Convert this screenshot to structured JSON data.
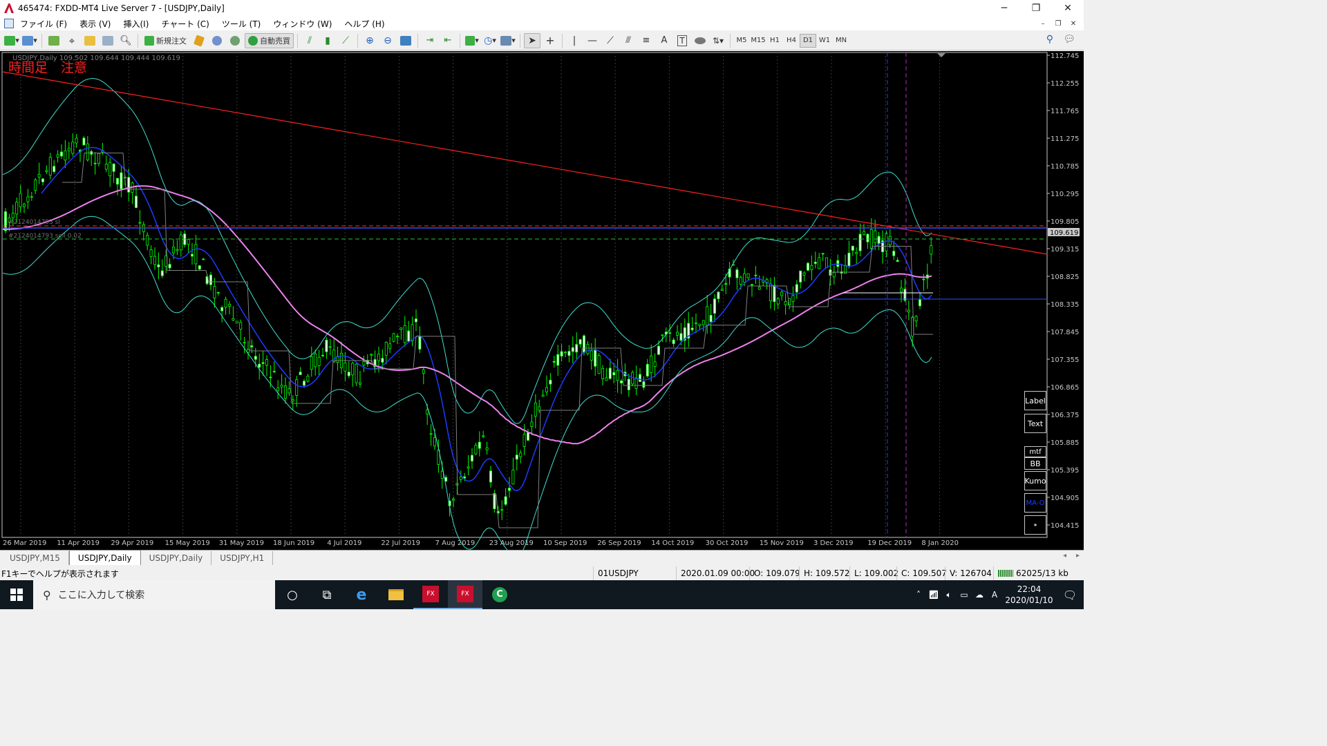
{
  "window": {
    "title": "465474: FXDD-MT4 Live Server 7 - [USDJPY,Daily]",
    "min": "─",
    "max": "❐",
    "close": "✕"
  },
  "menu": [
    "ファイル (F)",
    "表示 (V)",
    "挿入(I)",
    "チャート (C)",
    "ツール (T)",
    "ウィンドウ (W)",
    "ヘルプ (H)"
  ],
  "toolbar": {
    "new_order": "新規注文",
    "auto_trade": "自動売買",
    "timeframes": [
      "M5",
      "M15",
      "H1",
      "H4",
      "D1",
      "W1",
      "MN"
    ],
    "active_tf": "D1"
  },
  "chart": {
    "symbol_info": "USDJPY,Daily  109.502 109.644 109.444 109.619",
    "annotation": "時間足　注意",
    "order_label_1": "#2124014793 sl",
    "order_label_2": "#2124014793 sell 0.02",
    "current_price": "109.619",
    "price_axis": [
      "112.745",
      "112.255",
      "111.765",
      "111.275",
      "110.785",
      "110.295",
      "109.805",
      "109.315",
      "108.825",
      "108.335",
      "107.845",
      "107.355",
      "106.865",
      "106.375",
      "105.885",
      "105.395",
      "104.905",
      "104.415"
    ],
    "date_axis": [
      "26 Mar 2019",
      "11 Apr 2019",
      "29 Apr 2019",
      "15 May 2019",
      "31 May 2019",
      "18 Jun 2019",
      "4 Jul 2019",
      "22 Jul 2019",
      "7 Aug 2019",
      "23 Aug 2019",
      "10 Sep 2019",
      "26 Sep 2019",
      "14 Oct 2019",
      "30 Oct 2019",
      "15 Nov 2019",
      "3 Dec 2019",
      "19 Dec 2019",
      "8 Jan 2020"
    ],
    "side_buttons": [
      "Label",
      "Text",
      "mtf",
      "BB",
      "Kumo",
      "MA-O",
      "⁍"
    ],
    "colors": {
      "bg": "#000000",
      "candle": "#00ff00",
      "bb": "#40e0d0",
      "ma_short": "#1e3cff",
      "ma_long": "#ee82ee",
      "trend": "#ff2020",
      "ichimoku": "#808080"
    }
  },
  "tabs": [
    "USDJPY,M15",
    "USDJPY,Daily",
    "USDJPY,Daily",
    "USDJPY,H1"
  ],
  "active_tab": 1,
  "status": {
    "help": "F1キーでヘルプが表示されます",
    "profile": "01USDJPY",
    "datetime": "2020.01.09 00:00",
    "open": "O: 109.079",
    "high": "H: 109.572",
    "low": "L: 109.002",
    "close": "C: 109.507",
    "volume": "V: 126704",
    "traffic": "62025/13 kb"
  },
  "taskbar": {
    "search": "ここに入力して検索",
    "time": "22:04",
    "date": "2020/01/10",
    "ime": "A"
  }
}
